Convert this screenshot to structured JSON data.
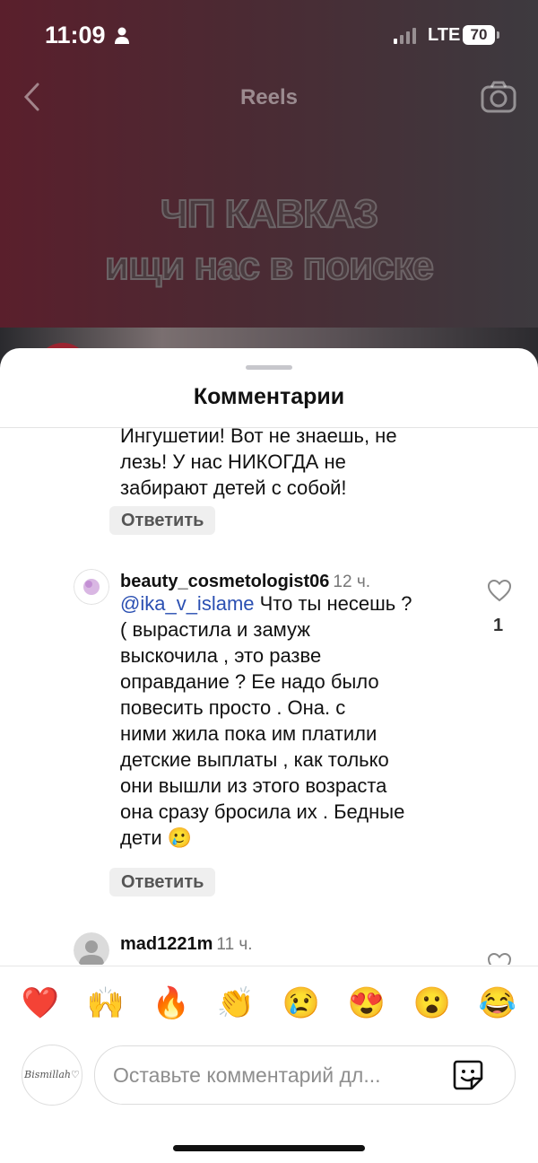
{
  "status_bar": {
    "time": "11:09",
    "network": "LTE",
    "battery": "70"
  },
  "nav": {
    "title": "Reels",
    "back_icon": "chevron-left-icon",
    "camera_icon": "camera-icon"
  },
  "overlay": {
    "line1": "ЧП КАВКАЗ",
    "line2": "ищи нас в поиске"
  },
  "sheet": {
    "title": "Комментарии"
  },
  "comments": [
    {
      "text_lines": [
        "Ингушетии! Вот не знаешь, не",
        "лезь!  У нас НИКОГДА не",
        "забирают детей с собой!"
      ],
      "reply_label": "Ответить"
    },
    {
      "username": "beauty_cosmetologist06",
      "time": "12 ч.",
      "mention": "@ika_v_islame",
      "text_first": " Что ты несешь ?",
      "text_lines": [
        "( вырастила и замуж",
        "выскочила , это разве",
        "оправдание ? Ее надо было",
        "повесить  просто . Она.  с",
        "ними жила пока им платили",
        "детские выплаты , как только",
        "они вышли из этого возраста",
        "она сразу бросила их . Бедные",
        "дети 🥲"
      ],
      "likes": "1",
      "reply_label": "Ответить"
    },
    {
      "username": "mad1221m",
      "time": "11 ч."
    }
  ],
  "emojis": [
    "❤️",
    "🙌",
    "🔥",
    "👏",
    "😢",
    "😍",
    "😮",
    "😂"
  ],
  "composer": {
    "placeholder": "Оставьте комментарий дл...",
    "avatar_text": "Bismillah♡"
  }
}
